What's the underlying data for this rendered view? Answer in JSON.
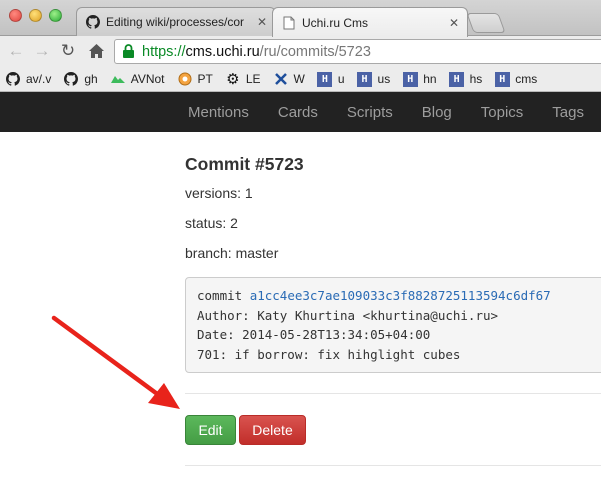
{
  "browser": {
    "tabs": [
      {
        "title": "Editing wiki/processes/cor",
        "icon": "github-icon",
        "active": false
      },
      {
        "title": "Uchi.ru Cms",
        "icon": "page-icon",
        "active": true
      }
    ],
    "address": {
      "scheme": "https://",
      "host": "cms.uchi.ru",
      "path": "/ru/commits/5723"
    },
    "bookmarks": [
      {
        "label": "av/.v",
        "icon": "github-icon"
      },
      {
        "label": "gh",
        "icon": "github-icon"
      },
      {
        "label": "AVNot",
        "icon": "cloud-icon"
      },
      {
        "label": "PT",
        "icon": "pt-icon"
      },
      {
        "label": "LE",
        "icon": "gear-icon"
      },
      {
        "label": "W",
        "icon": "tools-icon"
      },
      {
        "label": "u",
        "icon": "h-icon"
      },
      {
        "label": "us",
        "icon": "h-icon"
      },
      {
        "label": "hn",
        "icon": "h-icon"
      },
      {
        "label": "hs",
        "icon": "h-icon"
      },
      {
        "label": "cms",
        "icon": "h-icon"
      }
    ]
  },
  "nav": {
    "links": [
      "Mentions",
      "Cards",
      "Scripts",
      "Blog",
      "Topics",
      "Tags"
    ]
  },
  "commit": {
    "title": "Commit #5723",
    "versions": "versions: 1",
    "status": "status: 2",
    "branch": "branch: master",
    "details": {
      "commit_prefix": "commit ",
      "hash": "a1cc4ee3c7ae109033c3f8828725113594c6df67",
      "author": "Author: Katy Khurtina <khurtina@uchi.ru>",
      "date": "Date: 2014-05-28T13:34:05+04:00",
      "message": "701: if borrow: fix hihglight cubes"
    }
  },
  "actions": {
    "edit_label": "Edit",
    "delete_label": "Delete"
  },
  "colors": {
    "edit": "#5cb85c",
    "delete": "#d9534f",
    "navbar": "#222222",
    "arrow": "#e8231b"
  }
}
